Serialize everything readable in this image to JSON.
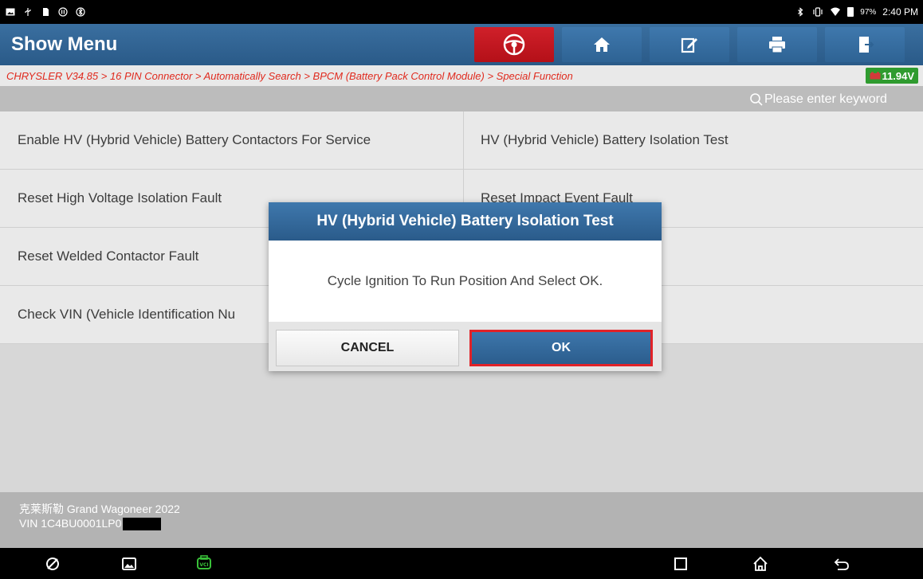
{
  "status_bar": {
    "battery_percent": "97%",
    "time": "2:40 PM"
  },
  "header": {
    "title": "Show Menu"
  },
  "breadcrumb": {
    "path": "CHRYSLER V34.85 > 16 PIN Connector > Automatically Search > BPCM (Battery Pack Control Module) > Special Function",
    "voltage": "11.94V"
  },
  "search": {
    "placeholder": "Please enter keyword"
  },
  "menu": {
    "items": [
      "Enable HV (Hybrid Vehicle) Battery Contactors For Service",
      "HV (Hybrid Vehicle) Battery Isolation Test",
      "Reset High Voltage Isolation Fault",
      "Reset Impact Event Fault",
      "Reset Welded Contactor Fault",
      "",
      "Check VIN (Vehicle Identification Nu",
      ""
    ]
  },
  "footer": {
    "vehicle": "克莱斯勒 Grand Wagoneer 2022",
    "vin": "VIN 1C4BU0001LP0"
  },
  "dialog": {
    "title": "HV (Hybrid Vehicle) Battery Isolation Test",
    "message": "Cycle Ignition To Run Position And Select OK.",
    "cancel_label": "CANCEL",
    "ok_label": "OK"
  },
  "colors": {
    "header_blue": "#2e6394",
    "breadcrumb_red": "#e02a1e",
    "voltage_green": "#2f9b2f",
    "toolbar_red": "#c8161f",
    "ok_highlight": "#e02228"
  }
}
